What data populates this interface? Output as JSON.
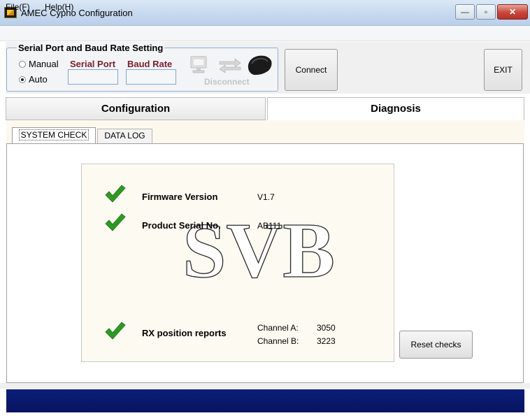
{
  "window": {
    "title": "AMEC Cypho Configuration",
    "minimize": "—",
    "maximize": "▫",
    "close": "✕"
  },
  "menu": {
    "file": "File(F)",
    "help": "Help(H)"
  },
  "serial": {
    "legend": "Serial Port and Baud Rate Setting",
    "manual_label": "Manual",
    "auto_label": "Auto",
    "selected_mode": "Auto",
    "serial_port_label": "Serial Port",
    "baud_rate_label": "Baud Rate",
    "serial_port_value": "",
    "baud_rate_value": "",
    "disconnect_label": "Disconnect"
  },
  "buttons": {
    "connect": "Connect",
    "exit": "EXIT",
    "reset_checks": "Reset checks"
  },
  "main_tabs": [
    {
      "label": "Configuration",
      "active": false
    },
    {
      "label": "Diagnosis",
      "active": true
    }
  ],
  "sub_tabs": [
    {
      "label": "SYSTEM CHECK",
      "active": true
    },
    {
      "label": "DATA LOG",
      "active": false
    }
  ],
  "checks": {
    "firmware": {
      "label": "Firmware Version",
      "value": "V1.7",
      "status": "ok"
    },
    "serial_no": {
      "label": "Product Serial No.",
      "value": "AB111",
      "status": "ok"
    },
    "rx": {
      "label": "RX position reports",
      "status": "ok",
      "channel_a_label": "Channel A:",
      "channel_a_value": "3050",
      "channel_b_label": "Channel B:",
      "channel_b_value": "3223"
    }
  },
  "logo_text": "SVB",
  "colors": {
    "check_green": "#2e9a22",
    "label_maroon": "#7b1e28",
    "status_bar": "#0a1a6e"
  }
}
